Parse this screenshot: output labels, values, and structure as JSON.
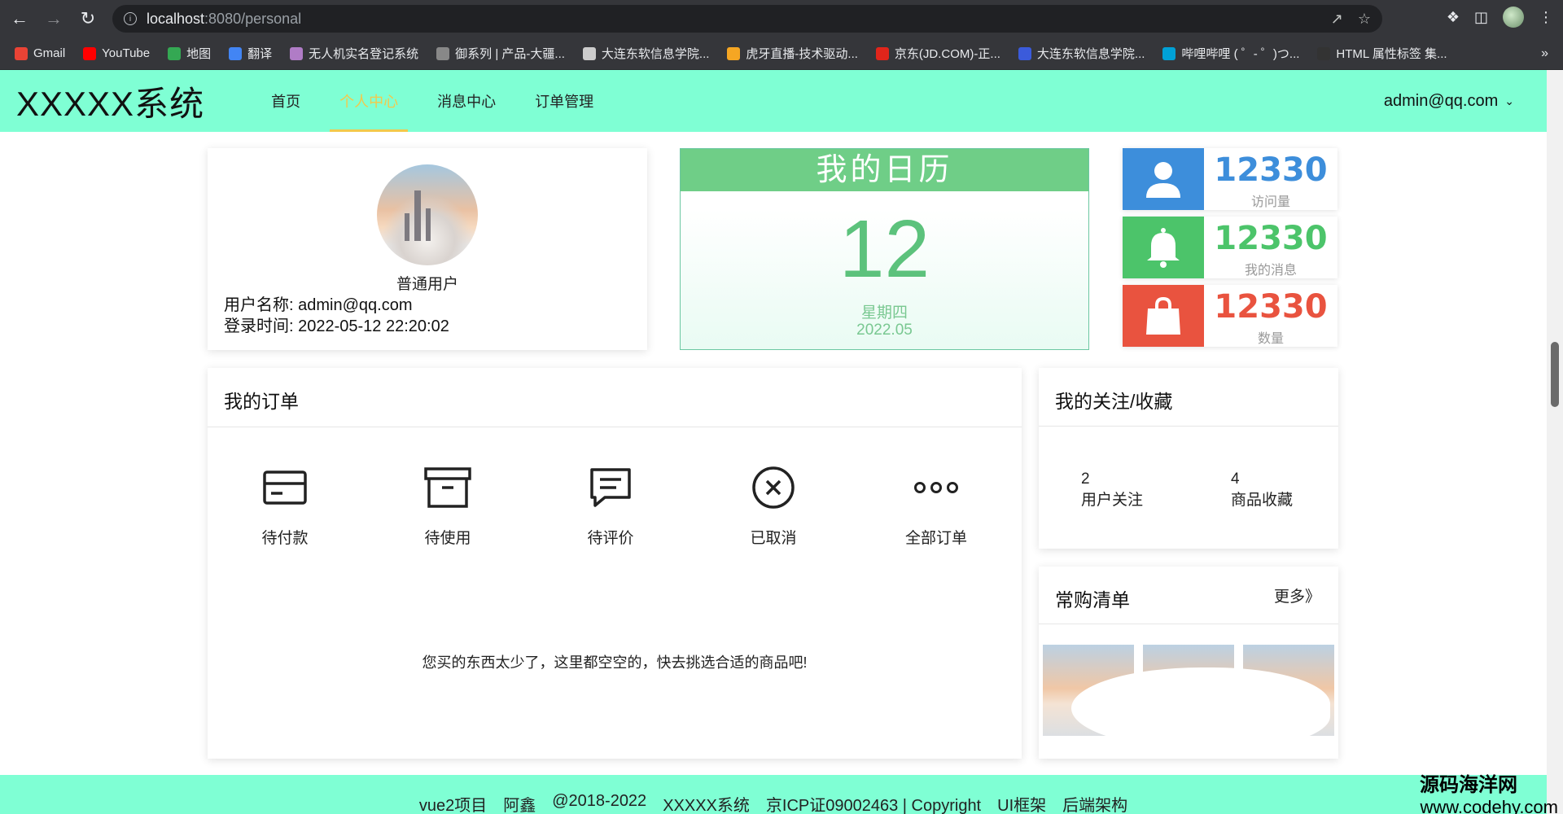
{
  "browser": {
    "url_host": "localhost",
    "url_path": ":8080/personal",
    "bookmarks": [
      {
        "label": "Gmail",
        "color": "#ea4335"
      },
      {
        "label": "YouTube",
        "color": "#ff0000"
      },
      {
        "label": "地图",
        "color": "#34a853"
      },
      {
        "label": "翻译",
        "color": "#4285f4"
      },
      {
        "label": "无人机实名登记系统",
        "color": "#b07cc6"
      },
      {
        "label": "御系列 | 产品-大疆...",
        "color": "#888888"
      },
      {
        "label": "大连东软信息学院...",
        "color": "#cccccc"
      },
      {
        "label": "虎牙直播-技术驱动...",
        "color": "#f5a623"
      },
      {
        "label": "京东(JD.COM)-正...",
        "color": "#e1251b"
      },
      {
        "label": "大连东软信息学院...",
        "color": "#3b5bdb"
      },
      {
        "label": "哔哩哔哩 ( ゜- ゜)つ...",
        "color": "#00a1d6"
      },
      {
        "label": "HTML 属性标签 集...",
        "color": "#333333"
      }
    ],
    "more": "»"
  },
  "header": {
    "logo": "XXXXX系统",
    "nav": [
      "首页",
      "个人中心",
      "消息中心",
      "订单管理"
    ],
    "active_index": 1,
    "user": "admin@qq.com",
    "colors": {
      "bg": "#7fffd4",
      "active": "#f2c94c"
    }
  },
  "profile": {
    "role": "普通用户",
    "username_label": "用户名称: admin@qq.com",
    "login_time_label": "登录时间: 2022-05-12 22:20:02"
  },
  "calendar": {
    "title": "我的日历",
    "day": "12",
    "weekday": "星期四",
    "month": "2022.05"
  },
  "stats": [
    {
      "value": "12330",
      "label": "访问量",
      "color": "#3d8edb",
      "icon": "user-icon"
    },
    {
      "value": "12330",
      "label": "我的消息",
      "color": "#4cc46a",
      "icon": "bell-icon"
    },
    {
      "value": "12330",
      "label": "数量",
      "color": "#e9533f",
      "icon": "bag-icon"
    }
  ],
  "orders": {
    "title": "我的订单",
    "items": [
      {
        "label": "待付款",
        "icon": "card-icon"
      },
      {
        "label": "待使用",
        "icon": "box-icon"
      },
      {
        "label": "待评价",
        "icon": "comment-icon"
      },
      {
        "label": "已取消",
        "icon": "cancel-icon"
      },
      {
        "label": "全部订单",
        "icon": "more-icon"
      }
    ],
    "empty_message": "您买的东西太少了，这里都空空的，快去挑选合适的商品吧!"
  },
  "follow": {
    "title": "我的关注/收藏",
    "items": [
      {
        "count": "2",
        "label": "用户关注"
      },
      {
        "count": "4",
        "label": "商品收藏"
      }
    ]
  },
  "buy_list": {
    "title": "常购清单",
    "more": "更多》"
  },
  "footer": [
    "vue2项目",
    "阿鑫",
    "@2018-2022",
    "XXXXX系统",
    "京ICP证09002463 | Copyright",
    "UI框架",
    "后端架构"
  ],
  "watermark": {
    "line1": "源码海洋网",
    "line2": "www.codehy.com"
  }
}
